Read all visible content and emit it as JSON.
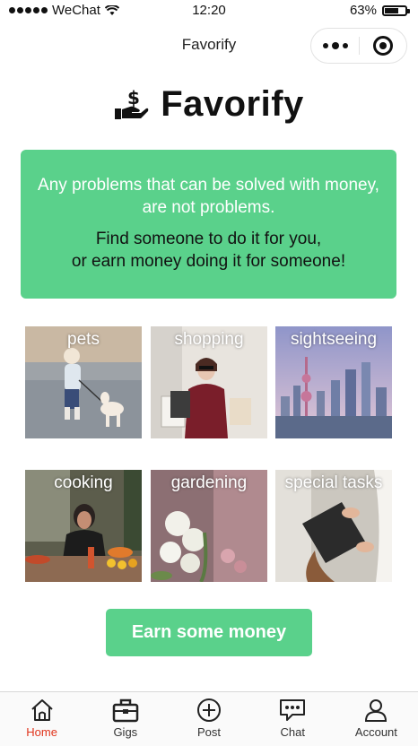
{
  "status_bar": {
    "carrier": "WeChat",
    "time": "12:20",
    "battery": "63%",
    "battery_level": 0.63
  },
  "nav": {
    "title": "Favorify"
  },
  "logo": {
    "text": "Favorify"
  },
  "banner": {
    "line1": "Any problems that can be solved with money, are not problems.",
    "line2": "Find someone to do it for you,",
    "line3": "or earn money doing it for someone!"
  },
  "categories": [
    {
      "label": "pets"
    },
    {
      "label": "shopping"
    },
    {
      "label": "sightseeing"
    },
    {
      "label": "cooking"
    },
    {
      "label": "gardening"
    },
    {
      "label": "special tasks"
    }
  ],
  "cta": {
    "label": "Earn some money"
  },
  "tabs": [
    {
      "label": "Home",
      "icon": "home-icon",
      "active": true
    },
    {
      "label": "Gigs",
      "icon": "briefcase-icon"
    },
    {
      "label": "Post",
      "icon": "plus-circle-icon"
    },
    {
      "label": "Chat",
      "icon": "chat-icon"
    },
    {
      "label": "Account",
      "icon": "person-icon"
    }
  ],
  "colors": {
    "accent": "#5ad18b",
    "active_tab": "#e0341c"
  }
}
